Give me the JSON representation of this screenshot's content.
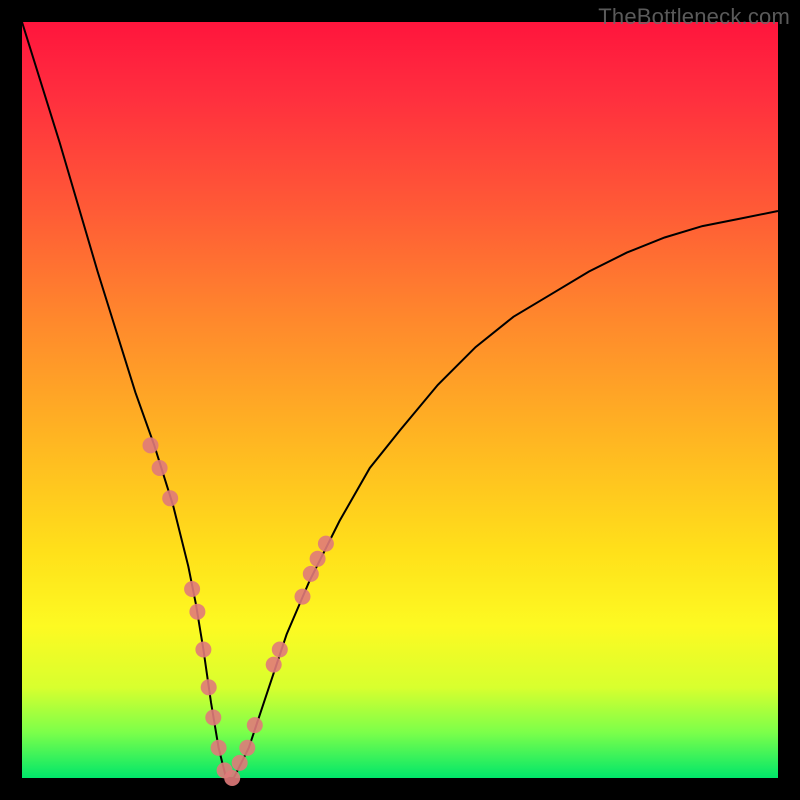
{
  "watermark": "TheBottleneck.com",
  "colors": {
    "frame_bg": "#000000",
    "curve": "#000000",
    "marker_fill": "#e07a7a",
    "gradient_stops": [
      "#ff153d",
      "#ff2f3e",
      "#ff5b36",
      "#ff8a2c",
      "#ffb522",
      "#ffe01a",
      "#fdfa22",
      "#d8ff2e",
      "#7bff4a",
      "#00e66a"
    ]
  },
  "chart_data": {
    "type": "line",
    "title": "",
    "xlabel": "",
    "ylabel": "",
    "xlim": [
      0,
      100
    ],
    "ylim": [
      0,
      100
    ],
    "x": [
      0,
      5,
      10,
      12.5,
      15,
      17.5,
      20,
      22,
      23,
      24,
      25,
      26,
      27,
      28,
      30,
      32,
      35,
      38,
      42,
      46,
      50,
      55,
      60,
      65,
      70,
      75,
      80,
      85,
      90,
      95,
      100
    ],
    "y": [
      100,
      84,
      67,
      59,
      51,
      44,
      36,
      28,
      23,
      17,
      10,
      4,
      0,
      0,
      4,
      10,
      19,
      26,
      34,
      41,
      46,
      52,
      57,
      61,
      64,
      67,
      69.5,
      71.5,
      73,
      74,
      75
    ],
    "series": [
      {
        "name": "bottleneck-curve",
        "note": "Black V-shaped curve; minimum near x≈27, y≈0; left branch starts at y=100, right branch asymptotes near y≈75."
      }
    ],
    "markers": [
      {
        "x": 17.0,
        "y": 44
      },
      {
        "x": 18.2,
        "y": 41
      },
      {
        "x": 19.6,
        "y": 37
      },
      {
        "x": 22.5,
        "y": 25
      },
      {
        "x": 23.2,
        "y": 22
      },
      {
        "x": 24.0,
        "y": 17
      },
      {
        "x": 24.7,
        "y": 12
      },
      {
        "x": 25.3,
        "y": 8
      },
      {
        "x": 26.0,
        "y": 4
      },
      {
        "x": 26.8,
        "y": 1
      },
      {
        "x": 27.8,
        "y": 0
      },
      {
        "x": 28.8,
        "y": 2
      },
      {
        "x": 29.8,
        "y": 4
      },
      {
        "x": 30.8,
        "y": 7
      },
      {
        "x": 33.3,
        "y": 15
      },
      {
        "x": 34.1,
        "y": 17
      },
      {
        "x": 37.1,
        "y": 24
      },
      {
        "x": 38.2,
        "y": 27
      },
      {
        "x": 39.1,
        "y": 29
      },
      {
        "x": 40.2,
        "y": 31
      }
    ],
    "marker_radius_px": 8
  }
}
